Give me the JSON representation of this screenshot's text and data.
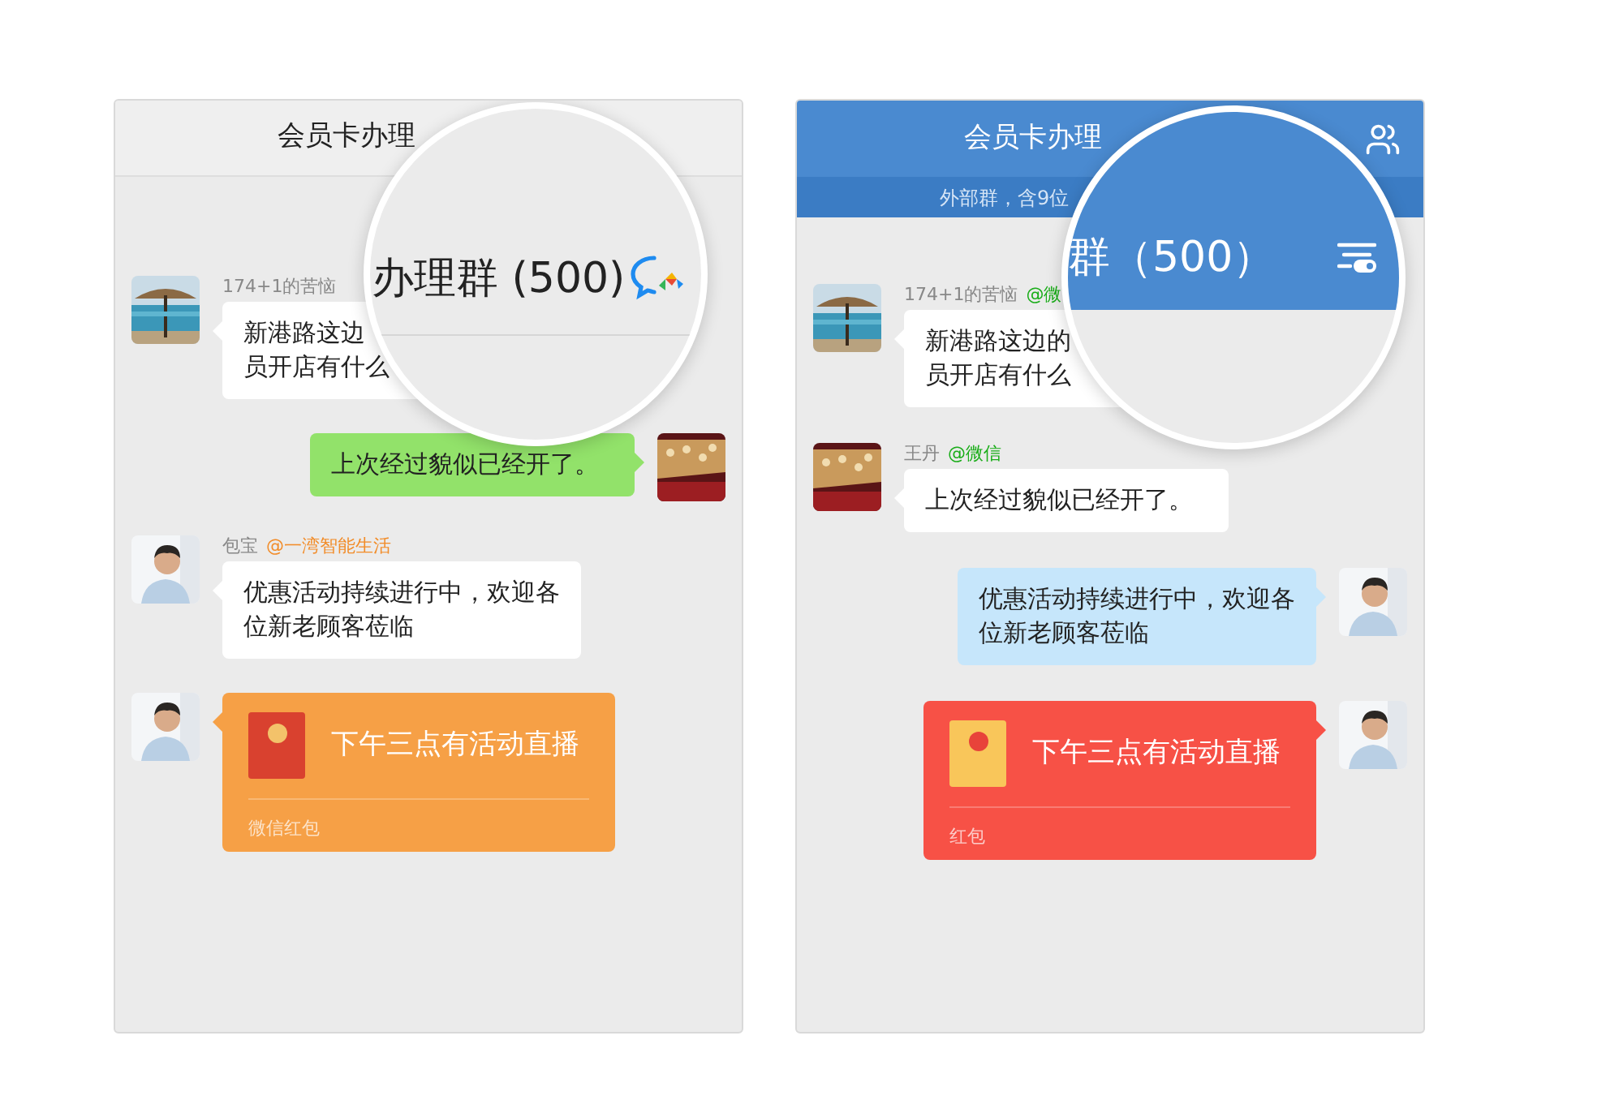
{
  "panels": [
    {
      "kind": "light",
      "title": "会员卡办理",
      "magnifier": {
        "title": "办理群 (500)"
      },
      "messages": [
        {
          "kind": "text",
          "outgoing": false,
          "sender": "174+1的苦恼",
          "lines": [
            "新港路这边",
            "员开店有什么"
          ],
          "color": "#ffffff"
        },
        {
          "kind": "text",
          "outgoing": true,
          "lines": [
            "上次经过貌似已经开了。"
          ],
          "color": "#92e26a"
        },
        {
          "kind": "text",
          "outgoing": false,
          "sender": "包宝",
          "tag": {
            "text": "@一湾智能生活",
            "color": "#f28c28"
          },
          "lines": [
            "优惠活动持续进行中，欢迎各",
            "位新老顾客莅临"
          ],
          "color": "#ffffff"
        },
        {
          "kind": "packet",
          "outgoing": false,
          "text": "下午三点有活动直播",
          "footer": "微信红包",
          "color": "#f6a046",
          "envelope": {
            "color": "#d9412f"
          }
        }
      ]
    },
    {
      "kind": "blue",
      "title": "会员卡办理",
      "subtitle": "外部群，含9位",
      "magnifier": {
        "title": "群（500）"
      },
      "messages": [
        {
          "kind": "text",
          "outgoing": false,
          "sender": "174+1的苦恼",
          "tag": {
            "text": "@微",
            "color": "#1aad19"
          },
          "lines": [
            "新港路这边的",
            "员开店有什么"
          ],
          "color": "#ffffff"
        },
        {
          "kind": "text",
          "outgoing": false,
          "sender": "王丹",
          "tag": {
            "text": "@微信",
            "color": "#1aad19"
          },
          "lines": [
            "上次经过貌似已经开了。"
          ],
          "color": "#ffffff"
        },
        {
          "kind": "text",
          "outgoing": true,
          "lines": [
            "优惠活动持续进行中，欢迎各",
            "位新老顾客莅临"
          ],
          "color": "#c6e6fb"
        },
        {
          "kind": "packet",
          "outgoing": true,
          "text": "下午三点有活动直播",
          "footer": "红包",
          "color": "#f75146",
          "envelope": {
            "color": "#f9c65a"
          }
        }
      ]
    }
  ]
}
